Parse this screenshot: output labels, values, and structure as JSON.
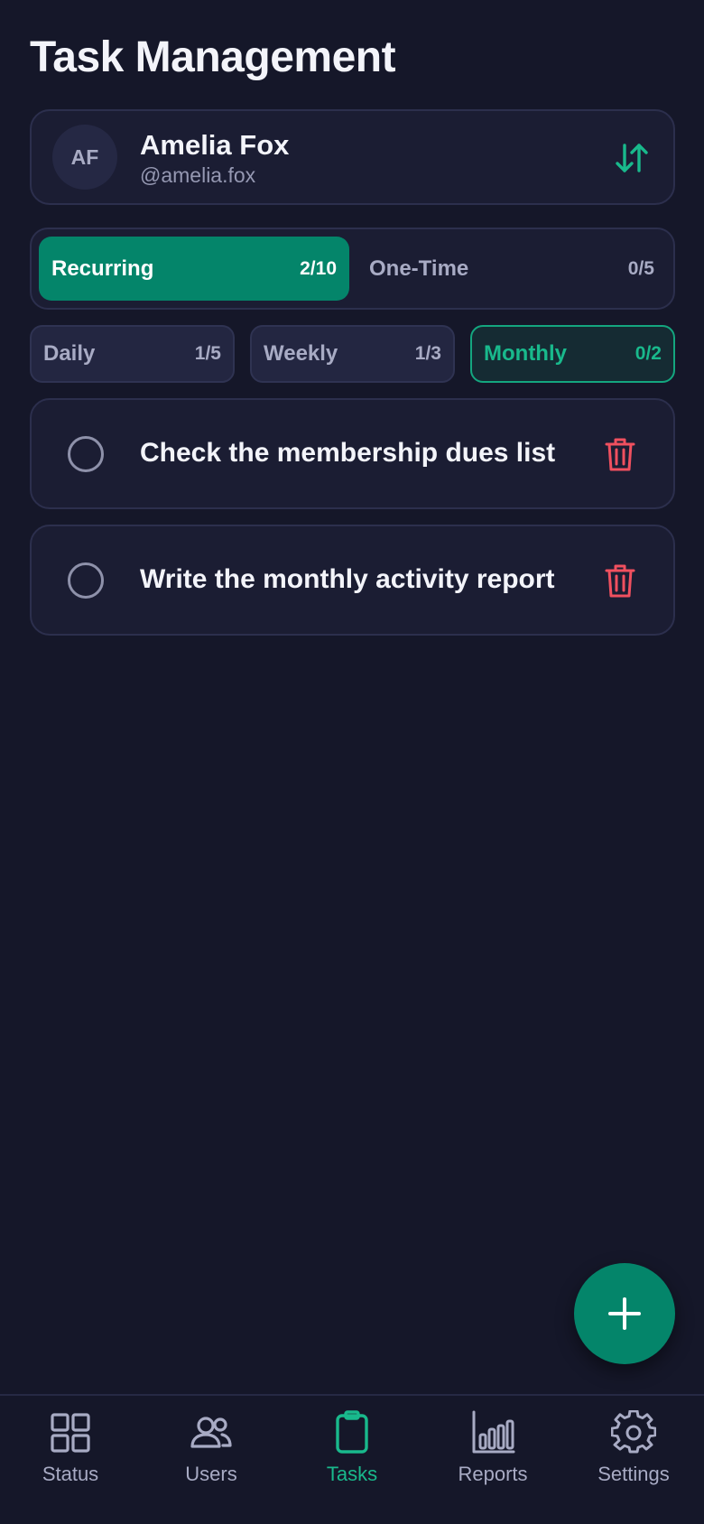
{
  "header": {
    "title": "Task Management"
  },
  "user": {
    "initials": "AF",
    "name": "Amelia Fox",
    "handle": "@amelia.fox",
    "switch_icon": "swap-vertical-icon"
  },
  "task_types": [
    {
      "label": "Recurring",
      "count": "2/10",
      "active": true
    },
    {
      "label": "One-Time",
      "count": "0/5",
      "active": false
    }
  ],
  "frequencies": [
    {
      "label": "Daily",
      "count": "1/5",
      "active": false
    },
    {
      "label": "Weekly",
      "count": "1/3",
      "active": false
    },
    {
      "label": "Monthly",
      "count": "0/2",
      "active": true
    }
  ],
  "tasks": [
    {
      "text": "Check the membership dues list",
      "done": false
    },
    {
      "text": "Write the monthly activity report",
      "done": false
    }
  ],
  "fab": {
    "icon": "plus-icon"
  },
  "nav": [
    {
      "label": "Status",
      "icon": "grid-icon",
      "active": false
    },
    {
      "label": "Users",
      "icon": "users-icon",
      "active": false
    },
    {
      "label": "Tasks",
      "icon": "clipboard-icon",
      "active": true
    },
    {
      "label": "Reports",
      "icon": "bar-chart-icon",
      "active": false
    },
    {
      "label": "Settings",
      "icon": "gear-icon",
      "active": false
    }
  ],
  "colors": {
    "background": "#151729",
    "card": "#1b1d33",
    "accent": "#04856a",
    "accent_text": "#19b98c",
    "danger": "#f0505f"
  }
}
